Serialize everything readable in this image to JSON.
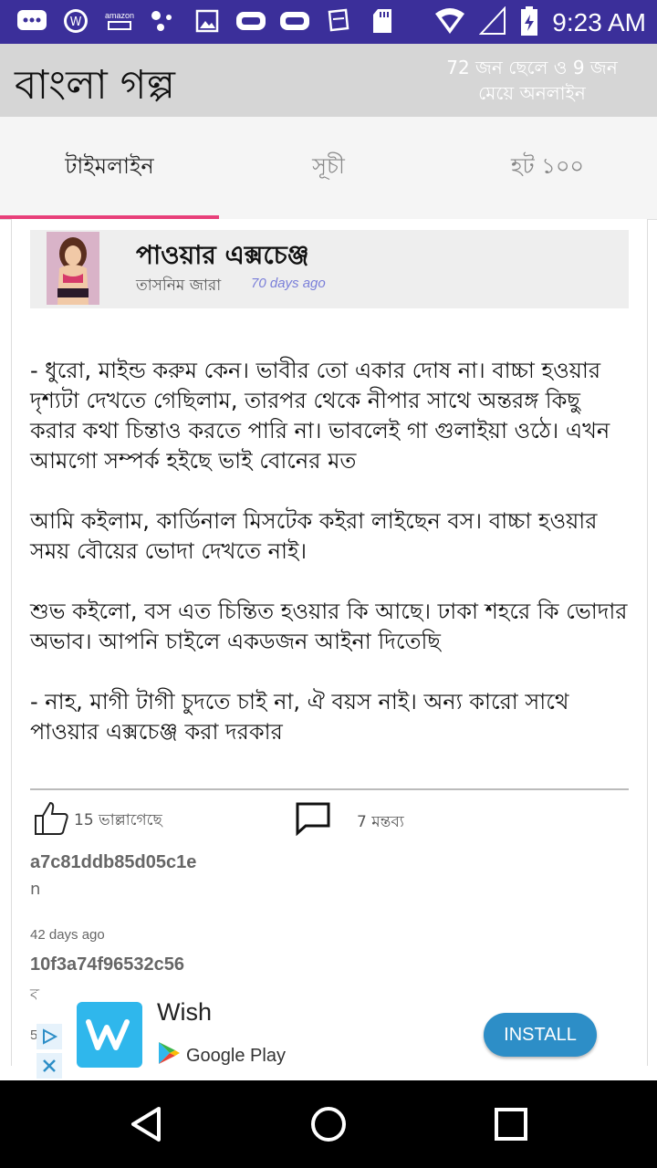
{
  "status_bar": {
    "time": "9:23 AM",
    "amazon_text": "amazon",
    "background": "#3b2f9a"
  },
  "app": {
    "title": "বাংলা গল্প",
    "online_line1": "72 জন ছেলে ও 9 জন",
    "online_line2": "মেয়ে অনলাইন"
  },
  "tabs": [
    {
      "label": "টাইমলাইন",
      "active": true
    },
    {
      "label": "সূচী",
      "active": false
    },
    {
      "label": "হট ১০০",
      "active": false
    }
  ],
  "accent_color": "#e8407a",
  "post": {
    "title": "পাওয়ার এক্সচেঞ্জ",
    "author": "তাসনিম জারা",
    "time_ago": "70 days ago",
    "paragraphs": [
      "- ধুরো, মাইন্ড করুম কেন। ভাবীর তো একার দোষ না। বাচ্চা হওয়ার দৃশ্যটা দেখতে গেছিলাম, তারপর থেকে নীপার সাথে অন্তরঙ্গ কিছু করার কথা চিন্তাও করতে পারি না। ভাবলেই গা গুলাইয়া ওঠে। এখন আমগো সম্পর্ক হইছে ভাই বোনের মত",
      "আমি কইলাম, কার্ডিনাল মিসটেক কইরা লাইছেন বস। বাচ্চা হওয়ার সময় বৌয়ের ভোদা দেখতে নাই।",
      "শুভ কইলো, বস এত চিন্তিত হওয়ার কি আছে। ঢাকা শহরে কি ভোদার অভাব। আপনি চাইলে একডজন আইনা দিতেছি",
      "- নাহ, মাগী টাগী চুদতে চাই না, ঐ বয়স নাই। অন্য কারো সাথে পাওয়ার এক্সচেঞ্জ করা দরকার"
    ],
    "likes": "15 ভাল্লাগেছে",
    "comments": "7 মন্তব্য"
  },
  "comment_list": [
    {
      "user": "a7c81ddb85d05c1e",
      "text": "n",
      "date": "42 days ago"
    },
    {
      "user": "10f3a74f96532c56",
      "text": "ব",
      "date": "5"
    }
  ],
  "ad": {
    "app_name": "Wish",
    "store": "Google Play",
    "install_label": "INSTALL"
  }
}
